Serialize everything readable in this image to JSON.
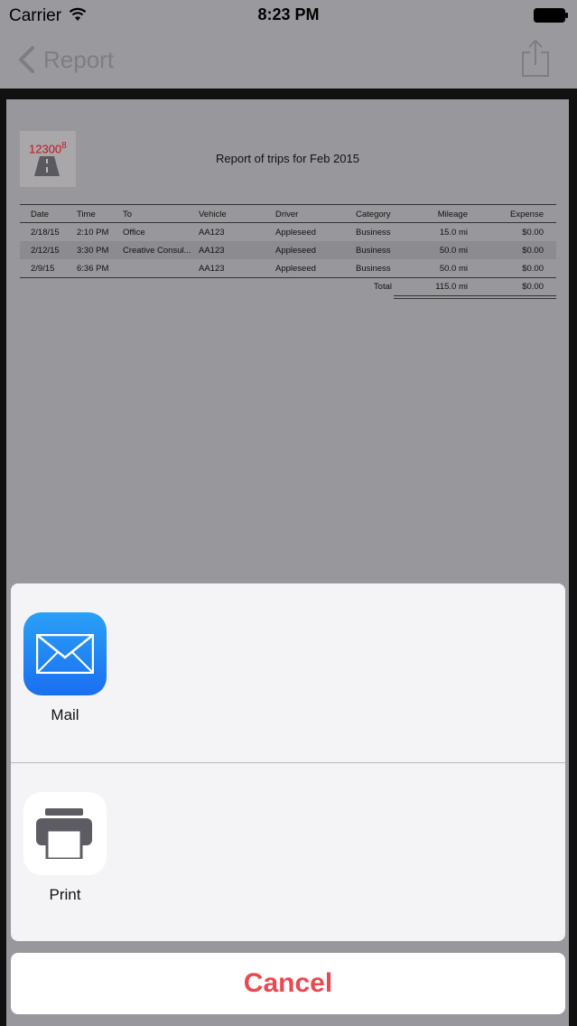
{
  "status_bar": {
    "carrier": "Carrier",
    "time": "8:23 PM"
  },
  "nav": {
    "back_label": "Report",
    "share_icon": "share-icon",
    "back_icon": "chevron-left-icon"
  },
  "report": {
    "logo_number": "12300",
    "logo_superscript": "8",
    "title": "Report of trips for Feb 2015",
    "columns": [
      "Date",
      "Time",
      "To",
      "Vehicle",
      "Driver",
      "Category",
      "Mileage",
      "Expense"
    ],
    "rows": [
      [
        "2/18/15",
        "2:10 PM",
        "Office",
        "AA123",
        "Appleseed",
        "Business",
        "15.0 mi",
        "$0.00"
      ],
      [
        "2/12/15",
        "3:30 PM",
        "Creative Consul...",
        "AA123",
        "Appleseed",
        "Business",
        "50.0 mi",
        "$0.00"
      ],
      [
        "2/9/15",
        "6:36 PM",
        "",
        "AA123",
        "Appleseed",
        "Business",
        "50.0 mi",
        "$0.00"
      ]
    ],
    "total_label": "Total",
    "total_mileage": "115.0 mi",
    "total_expense": "$0.00"
  },
  "share_sheet": {
    "apps": [
      {
        "label": "Mail",
        "icon": "mail-icon"
      },
      {
        "label": "Print",
        "icon": "printer-icon"
      }
    ],
    "cancel_label": "Cancel"
  },
  "colors": {
    "accent_red": "#e84a52",
    "mail_blue": "#1a8cf5"
  }
}
